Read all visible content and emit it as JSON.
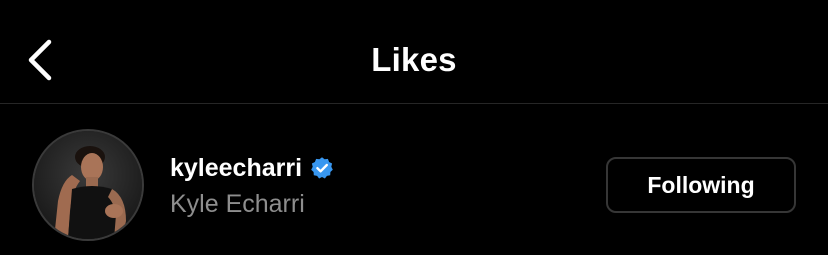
{
  "header": {
    "title": "Likes",
    "back_icon": "chevron-left-icon"
  },
  "likes": [
    {
      "username": "kyleecharri",
      "full_name": "Kyle Echarri",
      "verified": true,
      "verified_icon": "verified-badge-icon",
      "follow_button_label": "Following"
    }
  ],
  "colors": {
    "background": "#000000",
    "primary_text": "#ffffff",
    "secondary_text": "#8e8e8e",
    "divider": "#262626",
    "button_border": "#363636",
    "verified_blue": "#3897f0"
  }
}
